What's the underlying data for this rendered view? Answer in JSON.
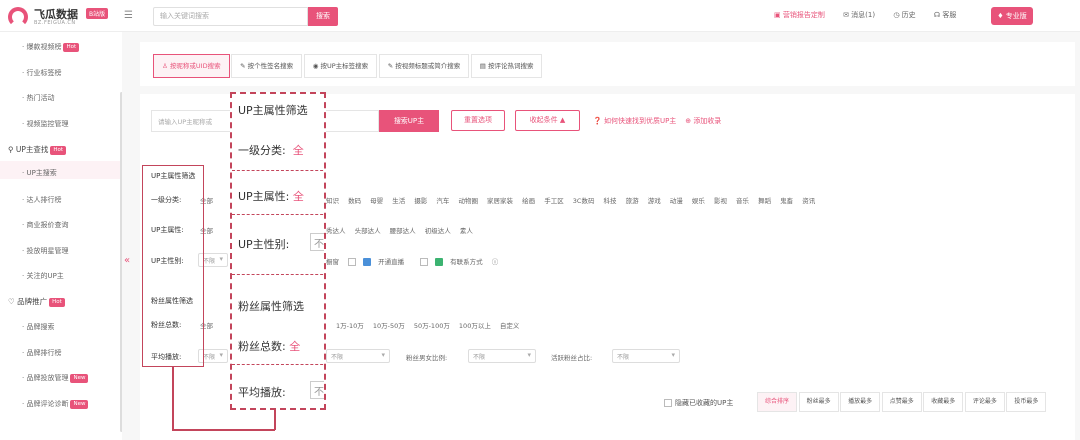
{
  "app": {
    "title": "飞瓜数据",
    "badge": "B站版",
    "domain": "BZ.FEIGUA.CN"
  },
  "topbar": {
    "search_placeholder": "输入关键词搜索",
    "search_btn": "搜索",
    "marketing_report": "营销报告定制",
    "messages": "消息(1)",
    "history": "历史",
    "service": "客服",
    "vip": "专业版"
  },
  "sidebar": {
    "items": [
      {
        "label": "爆款视频榜",
        "tag": "Hot"
      },
      {
        "label": "行业标签榜",
        "tag": ""
      },
      {
        "label": "热门活动",
        "tag": ""
      },
      {
        "label": "视频监控管理",
        "tag": ""
      }
    ],
    "group_up": {
      "label": "UP主查找",
      "tag": "Hot"
    },
    "up_items": [
      {
        "label": "UP主搜索"
      },
      {
        "label": "达人排行榜"
      },
      {
        "label": "商业报价查询"
      },
      {
        "label": "投放明星管理"
      },
      {
        "label": "关注的UP主"
      }
    ],
    "group_brand": {
      "label": "品牌推广",
      "tag": "Hot"
    },
    "brand_items": [
      {
        "label": "品牌搜索",
        "tag": ""
      },
      {
        "label": "品牌排行榜",
        "tag": ""
      },
      {
        "label": "品牌投放管理",
        "tag": "New"
      },
      {
        "label": "品牌评论诊断",
        "tag": "New"
      }
    ]
  },
  "tabs": [
    {
      "label": "按昵称或UID搜索"
    },
    {
      "label": "按个性签名搜索"
    },
    {
      "label": "按UP主标签搜索"
    },
    {
      "label": "按视频标题或简介搜索"
    },
    {
      "label": "按评论热词搜索"
    }
  ],
  "search": {
    "placeholder": "请输入UP主昵称或",
    "btn": "搜索UP主",
    "reset": "重置选项",
    "collapse": "收起条件 ▲",
    "help": "如何快速找到优质UP主",
    "add_fav": "添加收录"
  },
  "filters": {
    "up_section": "UP主属性筛选",
    "category_label": "一级分类:",
    "all": "全部",
    "categories": [
      "知识",
      "数码",
      "母婴",
      "生活",
      "摄影",
      "汽车",
      "动物圈",
      "家居家装",
      "绘画",
      "手工区",
      "3C数码",
      "科技",
      "旅游",
      "游戏",
      "动漫",
      "娱乐",
      "影视",
      "音乐",
      "舞蹈",
      "鬼畜",
      "资讯"
    ],
    "attr_label": "UP主属性:",
    "attrs": [
      "秀达人",
      "头部达人",
      "腰部达人",
      "初级达人",
      "素人"
    ],
    "gender_label": "UP主性别:",
    "gender_value": "不限",
    "cb_live_partial": "橱窗",
    "cb_live": "开通直播",
    "cb_contact": "有联系方式",
    "fans_section": "粉丝属性筛选",
    "fans_label": "粉丝总数:",
    "fans_ranges": [
      "1万-10万",
      "10万-50万",
      "50万-100万",
      "100万以上",
      "自定义"
    ],
    "play_label": "平均播放:",
    "play_value": "不限",
    "mid_select": "不限",
    "gender_ratio_label": "粉丝男女比例:",
    "gender_ratio_value": "不限",
    "active_label": "活跃粉丝占比:",
    "active_value": "不限"
  },
  "zoom": {
    "up_section": "UP主属性筛选",
    "category": "一级分类:",
    "all": "全",
    "attr": "UP主属性:",
    "gender": "UP主性别:",
    "gender_val": "不",
    "fans_section": "粉丝属性筛选",
    "fans": "粉丝总数:",
    "play": "平均播放:",
    "play_val": "不"
  },
  "sort": {
    "hide_fav": "隐藏已收藏的UP主",
    "items": [
      "综合排序",
      "粉丝最多",
      "播放最多",
      "点赞最多",
      "收藏最多",
      "评论最多",
      "投币最多"
    ]
  },
  "colors": {
    "accent": "#e8537a",
    "callout": "#c3455b"
  }
}
